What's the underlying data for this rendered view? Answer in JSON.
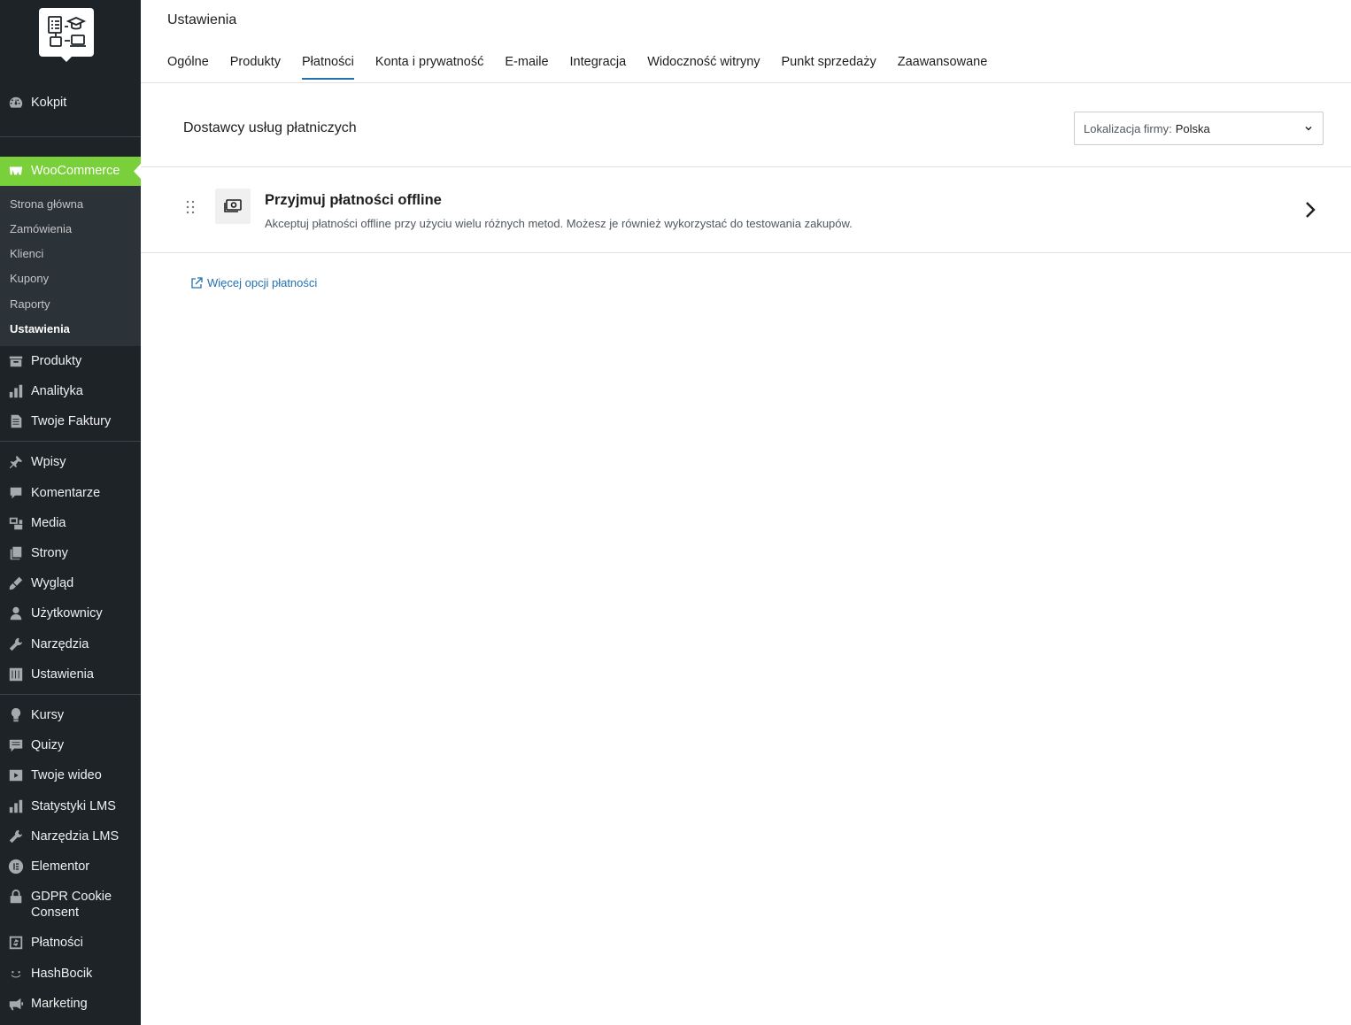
{
  "sidebar": {
    "top_items": [
      {
        "label": "Kokpit",
        "icon": "dashboard-icon"
      }
    ],
    "woocommerce": {
      "label": "WooCommerce",
      "icon": "woocommerce-icon"
    },
    "woo_submenu": [
      {
        "label": "Strona główna"
      },
      {
        "label": "Zamówienia"
      },
      {
        "label": "Klienci"
      },
      {
        "label": "Kupony"
      },
      {
        "label": "Raporty"
      },
      {
        "label": "Ustawienia",
        "current": true
      }
    ],
    "items_group1": [
      {
        "label": "Produkty",
        "icon": "archive-icon"
      },
      {
        "label": "Analityka",
        "icon": "bar-chart-icon"
      },
      {
        "label": "Twoje Faktury",
        "icon": "document-icon"
      }
    ],
    "items_group2": [
      {
        "label": "Wpisy",
        "icon": "pin-icon"
      },
      {
        "label": "Komentarze",
        "icon": "comment-icon"
      },
      {
        "label": "Media",
        "icon": "media-icon"
      },
      {
        "label": "Strony",
        "icon": "pages-icon"
      },
      {
        "label": "Wygląd",
        "icon": "brush-icon"
      },
      {
        "label": "Użytkownicy",
        "icon": "user-icon"
      },
      {
        "label": "Narzędzia",
        "icon": "wrench-icon"
      },
      {
        "label": "Ustawienia",
        "icon": "settings-sliders-icon"
      }
    ],
    "items_group3": [
      {
        "label": "Kursy",
        "icon": "lightbulb-icon"
      },
      {
        "label": "Quizy",
        "icon": "quiz-icon"
      },
      {
        "label": "Twoje wideo",
        "icon": "video-icon"
      },
      {
        "label": "Statystyki LMS",
        "icon": "bar-chart-icon"
      },
      {
        "label": "Narzędzia LMS",
        "icon": "wrench-icon"
      },
      {
        "label": "Elementor",
        "icon": "elementor-icon"
      },
      {
        "label": "GDPR Cookie Consent",
        "icon": "lock-icon"
      },
      {
        "label": "Płatności",
        "icon": "dollar-icon"
      },
      {
        "label": "HashBocik",
        "icon": "smile-icon"
      },
      {
        "label": "Marketing",
        "icon": "megaphone-icon"
      }
    ]
  },
  "header": {
    "title": "Ustawienia",
    "tabs": [
      {
        "label": "Ogólne"
      },
      {
        "label": "Produkty"
      },
      {
        "label": "Płatności",
        "active": true
      },
      {
        "label": "Konta i prywatność"
      },
      {
        "label": "E-maile"
      },
      {
        "label": "Integracja"
      },
      {
        "label": "Widoczność witryny"
      },
      {
        "label": "Punkt sprzedaży"
      },
      {
        "label": "Zaawansowane"
      }
    ]
  },
  "main": {
    "section_title": "Dostawcy usług płatniczych",
    "location": {
      "label": "Lokalizacja firmy:",
      "value": "Polska"
    },
    "card": {
      "title": "Przyjmuj płatności offline",
      "description": "Akceptuj płatności offline przy użyciu wielu różnych metod. Możesz je również wykorzystać do testowania zakupów."
    },
    "more_link": "Więcej opcji płatności"
  },
  "colors": {
    "sidebar_bg": "#1d2327",
    "woo_active": "#7ad03a",
    "accent": "#2271b1"
  }
}
